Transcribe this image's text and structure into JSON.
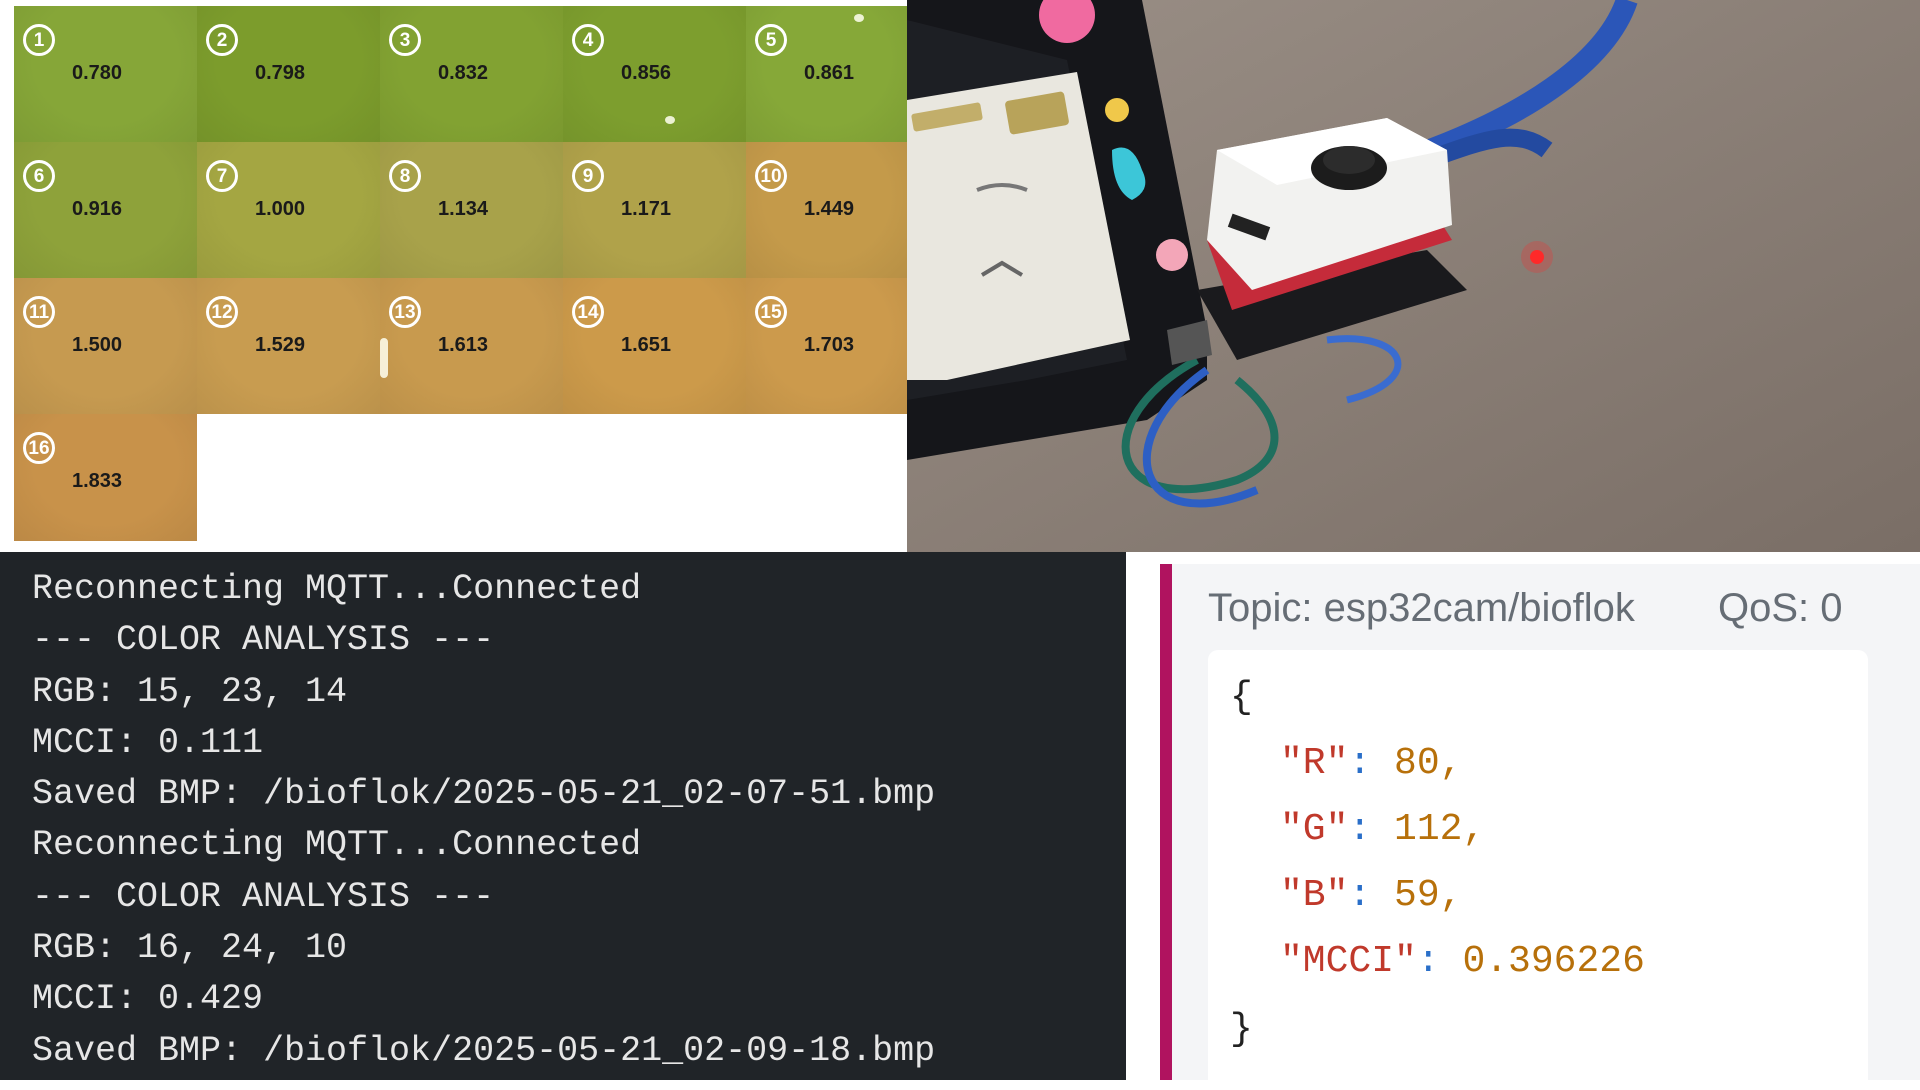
{
  "sample_grid": {
    "tiles": [
      {
        "num": "1",
        "value": "0.780",
        "color": "#86a638"
      },
      {
        "num": "2",
        "value": "0.798",
        "color": "#7c9c2c"
      },
      {
        "num": "3",
        "value": "0.832",
        "color": "#82a232"
      },
      {
        "num": "4",
        "value": "0.856",
        "color": "#7d9e2e"
      },
      {
        "num": "5",
        "value": "0.861",
        "color": "#86a838"
      },
      {
        "num": "6",
        "value": "0.916",
        "color": "#8ea23a"
      },
      {
        "num": "7",
        "value": "1.000",
        "color": "#a4a642"
      },
      {
        "num": "8",
        "value": "1.134",
        "color": "#a8a24a"
      },
      {
        "num": "9",
        "value": "1.171",
        "color": "#b0a24a"
      },
      {
        "num": "10",
        "value": "1.449",
        "color": "#c49a4a"
      },
      {
        "num": "11",
        "value": "1.500",
        "color": "#c69a50"
      },
      {
        "num": "12",
        "value": "1.529",
        "color": "#c89c50"
      },
      {
        "num": "13",
        "value": "1.613",
        "color": "#c89a4e"
      },
      {
        "num": "14",
        "value": "1.651",
        "color": "#cc9a4a"
      },
      {
        "num": "15",
        "value": "1.703",
        "color": "#cc9a4c"
      },
      {
        "num": "16",
        "value": "1.833",
        "color": "#c8924a"
      }
    ]
  },
  "serial_console": {
    "lines": [
      "Reconnecting MQTT...Connected",
      "--- COLOR ANALYSIS ---",
      "RGB: 15, 23, 14",
      "MCCI: 0.111",
      "Saved BMP: /bioflok/2025-05-21_02-07-51.bmp",
      "Reconnecting MQTT...Connected",
      "--- COLOR ANALYSIS ---",
      "RGB: 16, 24, 10",
      "MCCI: 0.429",
      "Saved BMP: /bioflok/2025-05-21_02-09-18.bmp"
    ]
  },
  "mqtt_message": {
    "topic": "Topic: esp32cam/bioflok",
    "qos": "QoS: 0",
    "open_brace": "{",
    "close_brace": "}",
    "fields": [
      {
        "key": "\"R\"",
        "value": "80,"
      },
      {
        "key": "\"G\"",
        "value": "112,"
      },
      {
        "key": "\"B\"",
        "value": "59,"
      },
      {
        "key": "\"MCCI\"",
        "value": "0.396226"
      }
    ],
    "accent_color": "#b0135f"
  }
}
